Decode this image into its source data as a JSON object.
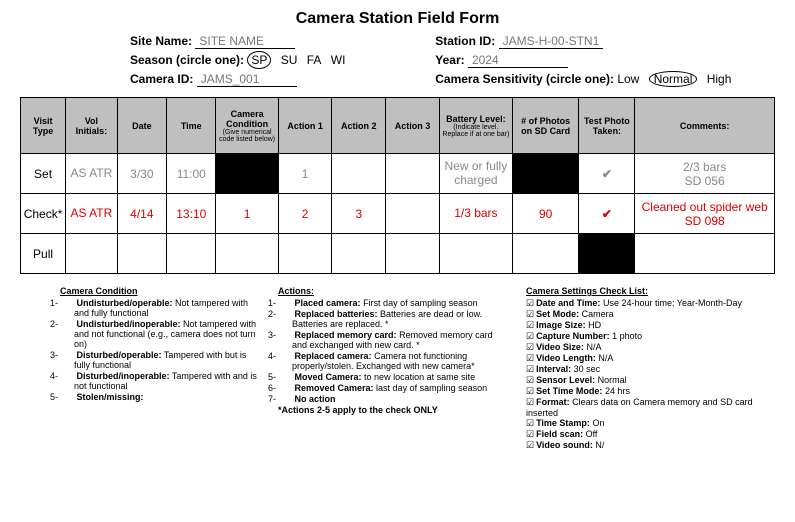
{
  "title": "Camera Station Field Form",
  "fields": {
    "site_name_label": "Site Name:",
    "site_name_value": "SITE NAME",
    "station_id_label": "Station ID:",
    "station_id_value": "JAMS-H-00-STN1",
    "season_label": "Season (circle one):",
    "season_options": {
      "sp": "SP",
      "su": "SU",
      "fa": "FA",
      "wi": "WI"
    },
    "season_selected": "SP",
    "year_label": "Year:",
    "year_value": "2024",
    "camera_id_label": "Camera ID:",
    "camera_id_value": "JAMS_001",
    "sensitivity_label": "Camera Sensitivity (circle one):",
    "sensitivity_options": {
      "low": "Low",
      "normal": "Normal",
      "high": "High"
    },
    "sensitivity_selected": "Normal"
  },
  "table": {
    "headers": {
      "visit": "Visit Type",
      "initials": "Vol Initials:",
      "date": "Date",
      "time": "Time",
      "condition": "Camera Condition",
      "condition_sub": "(Give numerical code listed below)",
      "a1": "Action 1",
      "a2": "Action 2",
      "a3": "Action 3",
      "battery": "Battery Level:",
      "battery_sub": "(Indicate level. Replace if at one bar)",
      "photos": "# of Photos on SD Card",
      "test": "Test Photo Taken:",
      "comments": "Comments:"
    },
    "rows": [
      {
        "type": "Set",
        "initials": "AS ATR",
        "date": "3/30",
        "time": "11:00",
        "cond": "",
        "a1": "1",
        "a2": "",
        "a3": "",
        "battery": "New or fully charged",
        "photos": "",
        "test": "✔",
        "comments": "2/3 bars\nSD 056",
        "style": "grey",
        "cond_black": true,
        "photos_black": true
      },
      {
        "type": "Check*",
        "initials": "AS ATR",
        "date": "4/14",
        "time": "13:10",
        "cond": "1",
        "a1": "2",
        "a2": "3",
        "a3": "",
        "battery": "1/3 bars",
        "photos": "90",
        "test": "✔",
        "comments": "Cleaned out spider web\nSD 098",
        "style": "red",
        "cond_black": false,
        "photos_black": false
      },
      {
        "type": "Pull",
        "initials": "",
        "date": "",
        "time": "",
        "cond": "",
        "a1": "",
        "a2": "",
        "a3": "",
        "battery": "",
        "photos": "",
        "test": "",
        "comments": "",
        "style": "",
        "cond_black": false,
        "photos_black": false,
        "test_black": true
      }
    ]
  },
  "legend_condition": {
    "title": "Camera Condition",
    "items": [
      "Undisturbed/operable: Not tampered with and fully functional",
      "Undisturbed/inoperable: Not tampered with and not functional (e.g., camera does not turn on)",
      "Disturbed/operable: Tampered with but is fully functional",
      "Disturbed/inoperable: Tampered with and is not functional",
      "Stolen/missing"
    ]
  },
  "legend_actions": {
    "title": "Actions:",
    "items": [
      "Placed camera: First day of sampling season",
      "Replaced batteries: Batteries are dead or low. Batteries are replaced. *",
      "Replaced memory card: Removed memory card and exchanged with new card. *",
      "Replaced camera: Camera not functioning properly/stolen. Exchanged with new camera*",
      "Moved Camera: to new location at same site",
      "Removed Camera: last day of sampling season",
      "No action"
    ],
    "footer": "*Actions 2-5 apply to the check ONLY"
  },
  "legend_settings": {
    "title": "Camera Settings Check List:",
    "items": [
      "Date and Time: Use 24-hour time; Year-Month-Day",
      "Set Mode: Camera",
      "Image Size: HD",
      "Capture Number: 1 photo",
      "Video Size: N/A",
      "Video Length: N/A",
      "Interval: 30 sec",
      "Sensor Level: Normal",
      "Set Time Mode: 24 hrs",
      "Format: Clears data on Camera memory and SD card inserted",
      "Time Stamp: On",
      "Field scan: Off",
      "Video sound: N/"
    ]
  }
}
